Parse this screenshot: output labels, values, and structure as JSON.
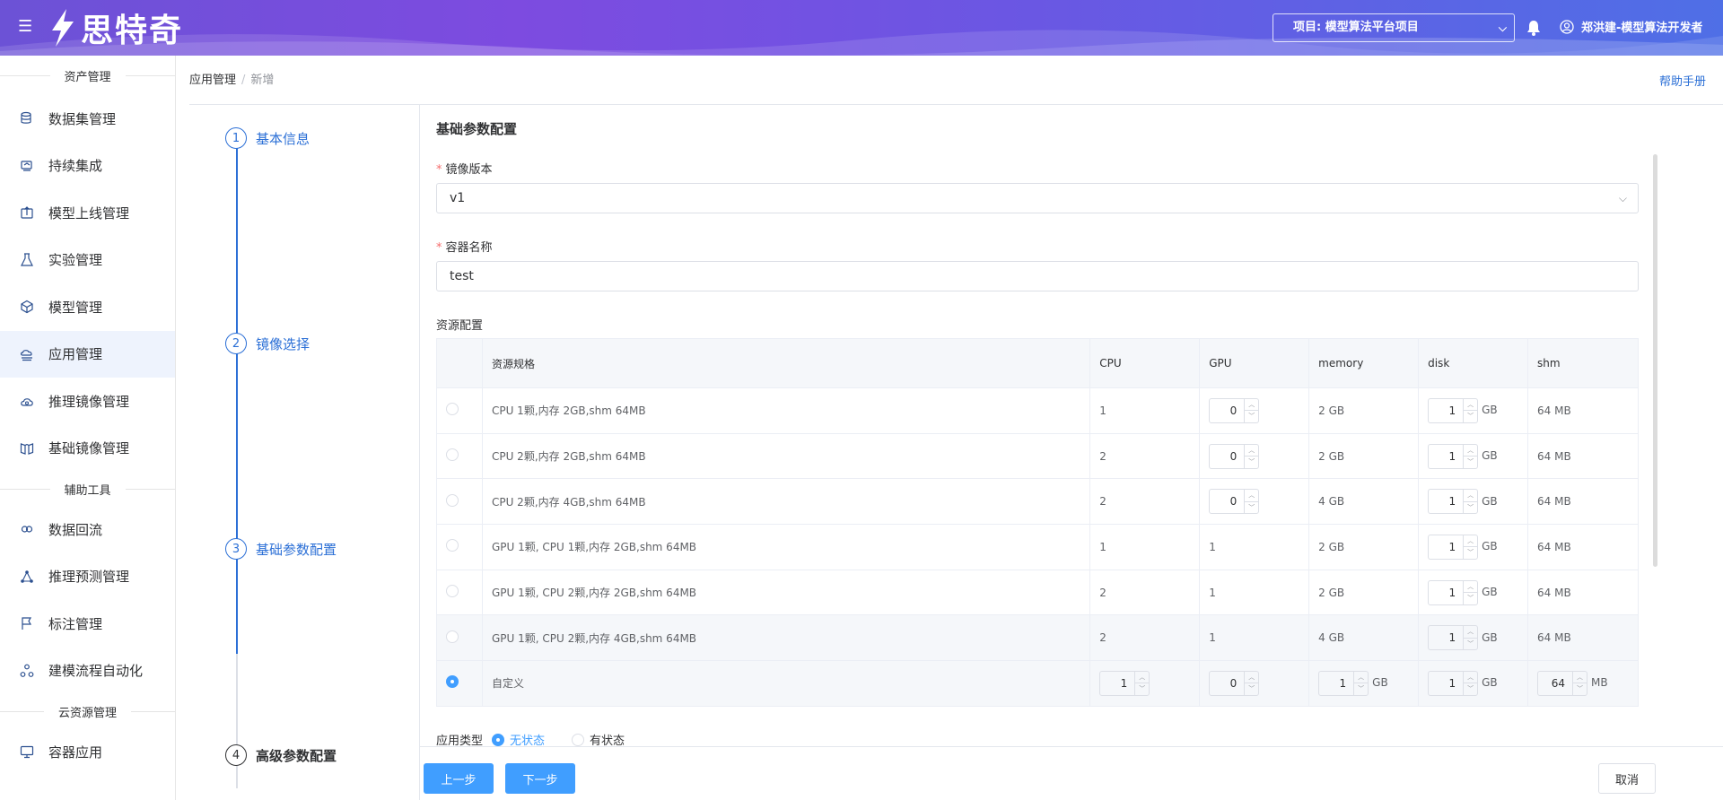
{
  "header": {
    "logo_text": "思特奇",
    "project_select": "项目: 模型算法平台项目",
    "user": "郑洪建-模型算法开发者"
  },
  "sidebar": {
    "groups": [
      {
        "title": "资产管理",
        "items": [
          "数据集管理",
          "持续集成",
          "模型上线管理",
          "实验管理",
          "模型管理",
          "应用管理",
          "推理镜像管理",
          "基础镜像管理"
        ]
      },
      {
        "title": "辅助工具",
        "items": [
          "数据回流",
          "推理预测管理",
          "标注管理",
          "建模流程自动化"
        ]
      },
      {
        "title": "云资源管理",
        "items": [
          "容器应用"
        ]
      }
    ],
    "active_item": "应用管理"
  },
  "breadcrumb": [
    "应用管理",
    "新增"
  ],
  "help_label": "帮助手册",
  "steps": [
    {
      "num": "1",
      "label": "基本信息",
      "state": "done"
    },
    {
      "num": "2",
      "label": "镜像选择",
      "state": "done"
    },
    {
      "num": "3",
      "label": "基础参数配置",
      "state": "active"
    },
    {
      "num": "4",
      "label": "高级参数配置",
      "state": "pending"
    }
  ],
  "form": {
    "section_title": "基础参数配置",
    "image_version": {
      "label": "镜像版本",
      "value": "v1"
    },
    "container_name": {
      "label": "容器名称",
      "value": "test"
    },
    "resource_label": "资源配置",
    "table": {
      "headers": [
        "资源规格",
        "CPU",
        "GPU",
        "memory",
        "disk",
        "shm"
      ],
      "rows": [
        {
          "spec": "CPU 1颗,内存 2GB,shm 64MB",
          "cpu": "1",
          "gpu": "0",
          "gpu_editable": true,
          "memory": "2 GB",
          "disk": "1",
          "disk_unit": "GB",
          "shm": "64 MB"
        },
        {
          "spec": "CPU 2颗,内存 2GB,shm 64MB",
          "cpu": "2",
          "gpu": "0",
          "gpu_editable": true,
          "memory": "2 GB",
          "disk": "1",
          "disk_unit": "GB",
          "shm": "64 MB"
        },
        {
          "spec": "CPU 2颗,内存 4GB,shm 64MB",
          "cpu": "2",
          "gpu": "0",
          "gpu_editable": true,
          "memory": "4 GB",
          "disk": "1",
          "disk_unit": "GB",
          "shm": "64 MB"
        },
        {
          "spec": "GPU 1颗, CPU 1颗,内存 2GB,shm 64MB",
          "cpu": "1",
          "gpu": "1",
          "gpu_editable": false,
          "memory": "2 GB",
          "disk": "1",
          "disk_unit": "GB",
          "shm": "64 MB"
        },
        {
          "spec": "GPU 1颗, CPU 2颗,内存 2GB,shm 64MB",
          "cpu": "2",
          "gpu": "1",
          "gpu_editable": false,
          "memory": "2 GB",
          "disk": "1",
          "disk_unit": "GB",
          "shm": "64 MB"
        },
        {
          "spec": "GPU 1颗, CPU 2颗,内存 4GB,shm 64MB",
          "cpu": "2",
          "gpu": "1",
          "gpu_editable": false,
          "memory": "4 GB",
          "disk": "1",
          "disk_unit": "GB",
          "shm": "64 MB"
        }
      ],
      "custom": {
        "spec": "自定义",
        "cpu": "1",
        "gpu": "0",
        "memory": "1",
        "memory_unit": "GB",
        "disk": "1",
        "disk_unit": "GB",
        "shm": "64",
        "shm_unit": "MB"
      }
    },
    "app_type": {
      "label": "应用类型",
      "options": [
        "无状态",
        "有状态"
      ],
      "selected": "无状态"
    }
  },
  "footer": {
    "prev": "上一步",
    "next": "下一步",
    "cancel": "取消"
  },
  "colors": {
    "primary": "#409eff",
    "link": "#2b6fd6",
    "header_start": "#6c52d6",
    "header_end": "#4f6fe6"
  }
}
